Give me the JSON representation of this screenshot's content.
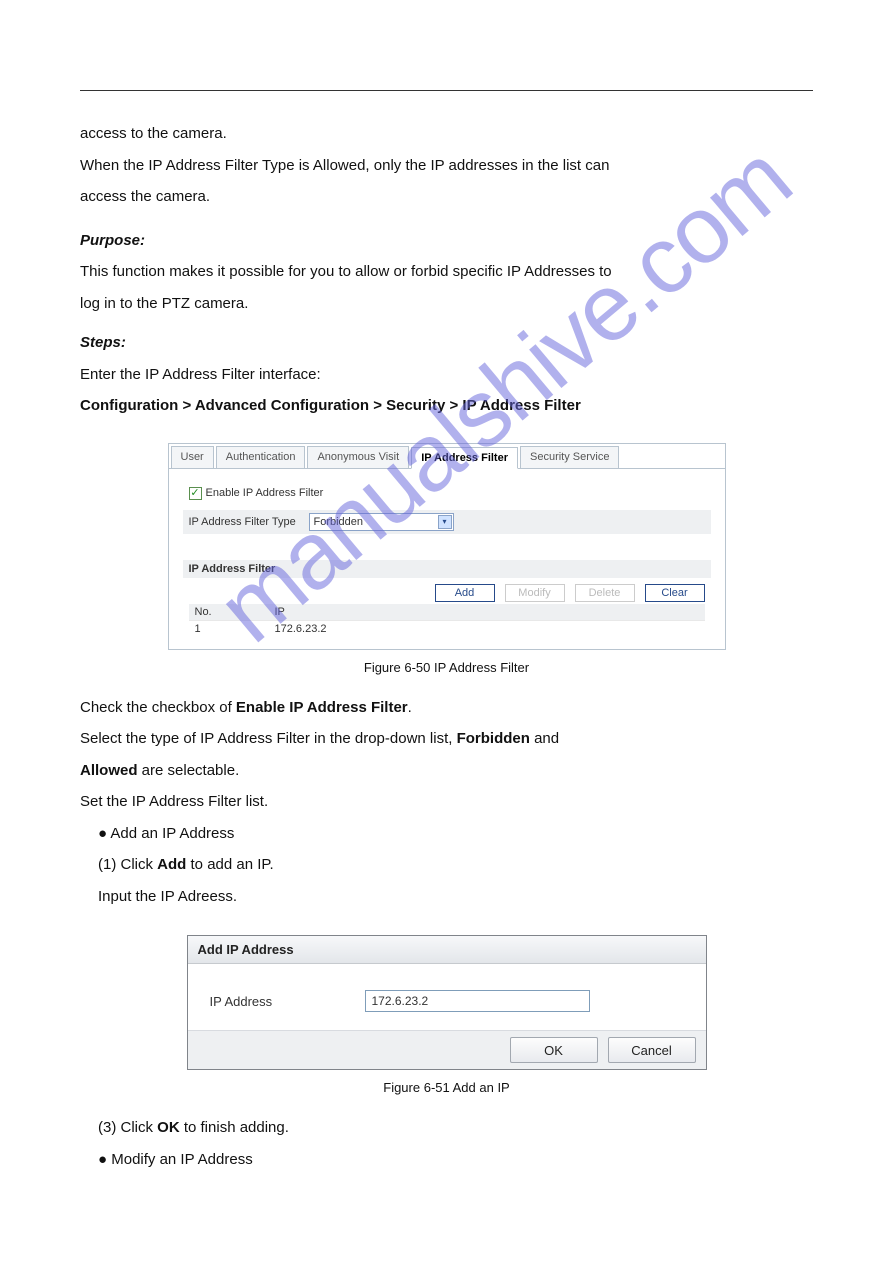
{
  "watermark": "manualshive.com",
  "intro": {
    "line1": "access to the camera.",
    "line2": "When the IP Address Filter Type is Allowed, only the IP addresses in the list can",
    "line3": "access the camera."
  },
  "purpose_label": "Purpose:",
  "purpose_text": "This function makes it possible for you to allow or forbid specific IP Addresses to",
  "purpose_text2": "log in to the PTZ camera.",
  "steps_label": "Steps:",
  "step1": "Enter the IP Address Filter interface:",
  "step1_path": "Configuration > Advanced Configuration > Security > IP Address Filter",
  "panel": {
    "tabs": [
      "User",
      "Authentication",
      "Anonymous Visit",
      "IP Address Filter",
      "Security Service"
    ],
    "activeTabIndex": 3,
    "enableLabel": "Enable IP Address Filter",
    "filterTypeLabel": "IP Address Filter Type",
    "filterTypeValue": "Forbidden",
    "sectionLabel": "IP Address Filter",
    "buttons": {
      "add": "Add",
      "modify": "Modify",
      "delete": "Delete",
      "clear": "Clear"
    },
    "tableHeader": {
      "no": "No.",
      "ip": "IP"
    },
    "rows": [
      {
        "no": "1",
        "ip": "172.6.23.2"
      }
    ]
  },
  "fig1_caption": "Figure 6-50 IP Address Filter",
  "step2": "Check the checkbox of Enable IP Address Filter.",
  "step3a": "Select the type of IP Address Filter in the drop-down list, Forbidden and",
  "step3b": "Allowed are selectable.",
  "step4": "Set the IP Address Filter list.",
  "bullet1": "Add an IP Address",
  "sub1": "Click Add to add an IP.",
  "sub2": "Input the IP Adreess.",
  "dialog": {
    "title": "Add IP Address",
    "label": "IP Address",
    "value": "172.6.23.2",
    "ok": "OK",
    "cancel": "Cancel"
  },
  "fig2_caption": "Figure 6-51 Add an IP",
  "sub3": "Click OK to finish adding.",
  "bullet2": "Modify an IP Address"
}
